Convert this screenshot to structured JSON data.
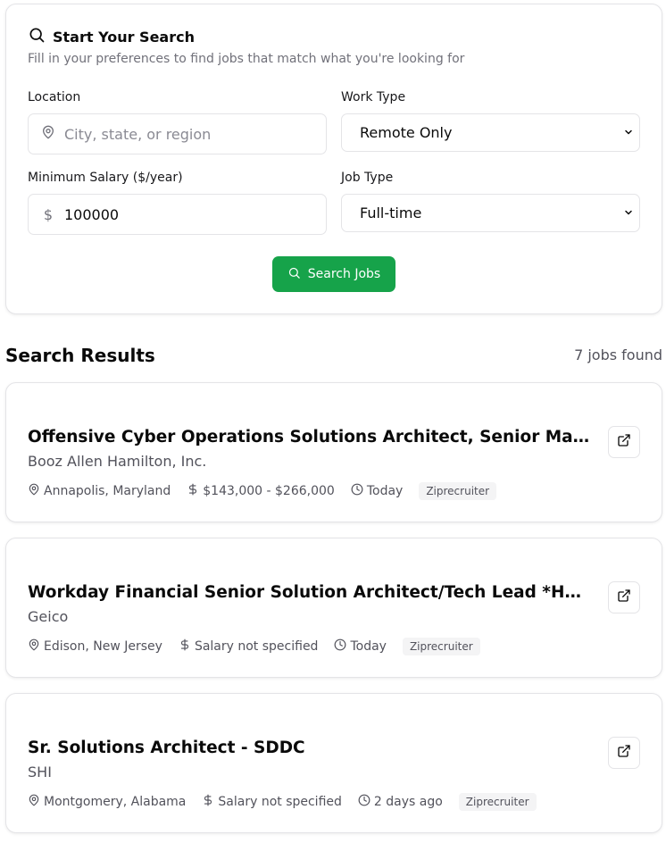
{
  "search": {
    "title": "Start Your Search",
    "subtitle": "Fill in your preferences to find jobs that match what you're looking for",
    "location_label": "Location",
    "location_placeholder": "City, state, or region",
    "location_value": "",
    "work_type_label": "Work Type",
    "work_type_value": "Remote Only",
    "salary_label": "Minimum Salary ($/year)",
    "salary_prefix": "$",
    "salary_value": "100000",
    "job_type_label": "Job Type",
    "job_type_value": "Full-time",
    "button_label": "Search Jobs"
  },
  "results": {
    "title": "Search Results",
    "count": "7 jobs found",
    "jobs": [
      {
        "title": "Offensive Cyber Operations Solutions Architect, Senior Manager",
        "company": "Booz Allen Hamilton, Inc.",
        "location": "Annapolis, Maryland",
        "salary": "$143,000 - $266,000",
        "posted": "Today",
        "source": "Ziprecruiter"
      },
      {
        "title": "Workday Financial Senior Solution Architect/Tech Lead *Hybrid*",
        "company": "Geico",
        "location": "Edison, New Jersey",
        "salary": "Salary not specified",
        "posted": "Today",
        "source": "Ziprecruiter"
      },
      {
        "title": "Sr. Solutions Architect - SDDC",
        "company": "SHI",
        "location": "Montgomery, Alabama",
        "salary": "Salary not specified",
        "posted": "2 days ago",
        "source": "Ziprecruiter"
      }
    ]
  },
  "colors": {
    "accent": "#16a34a",
    "border": "#e4e4e7",
    "muted_text": "#71717a"
  },
  "icons": {
    "title": "search-icon",
    "location": "map-pin-icon",
    "salary": "dollar-icon",
    "posted": "clock-icon",
    "external": "external-link-icon",
    "select": "chevron-down-icon"
  }
}
